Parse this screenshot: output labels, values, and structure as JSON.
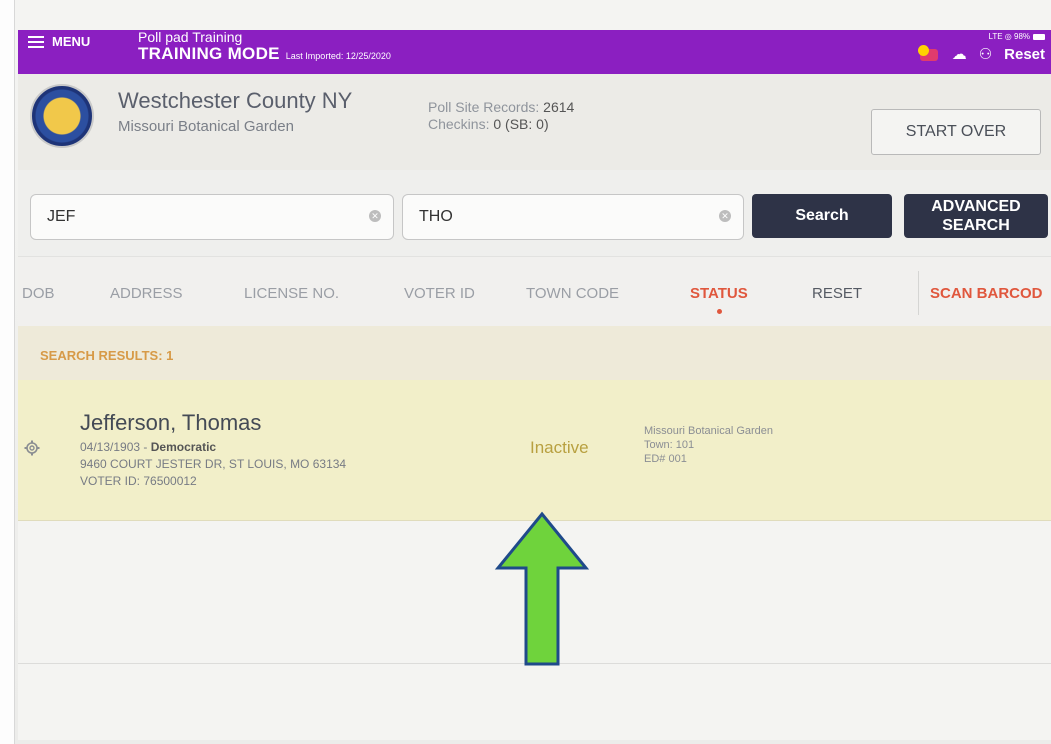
{
  "topbar": {
    "menu_label": "MENU",
    "app_title": "Poll pad Training",
    "mode": "TRAINING MODE",
    "last_imported": "Last Imported: 12/25/2020",
    "signal": "LTE ◎ 98%",
    "reset_label": "Reset"
  },
  "header": {
    "county": "Westchester County NY",
    "site": "Missouri Botanical Garden",
    "records_label": "Poll Site Records:",
    "records_value": "2614",
    "checkins_label": "Checkins:",
    "checkins_value": "0 (SB: 0)",
    "start_over": "START OVER"
  },
  "search": {
    "first_value": "JEF",
    "last_value": "THO",
    "search_label": "Search",
    "advanced_label": "ADVANCED SEARCH"
  },
  "filters": {
    "dob": "DOB",
    "address": "ADDRESS",
    "license": "LICENSE NO.",
    "voter_id": "VOTER ID",
    "town_code": "TOWN CODE",
    "status": "STATUS",
    "reset": "RESET",
    "scan": "SCAN BARCOD"
  },
  "results": {
    "count_label": "SEARCH RESULTS: 1",
    "items": [
      {
        "name": "Jefferson, Thomas",
        "dob": "04/13/1903",
        "party": "Democratic",
        "address": "9460 COURT JESTER DR, ST LOUIS, MO 63134",
        "voter_id": "VOTER ID: 76500012",
        "status": "Inactive",
        "poll_site": "Missouri Botanical Garden",
        "town": "Town: 101",
        "ed": "ED# 001"
      }
    ]
  },
  "colors": {
    "topbar": "#8b1fc1",
    "accent": "#e0573d",
    "button_dark": "#2e3347",
    "result_row": "#f2efc9",
    "arrow_fill": "#6fd33c",
    "arrow_stroke": "#1f4a8a"
  }
}
